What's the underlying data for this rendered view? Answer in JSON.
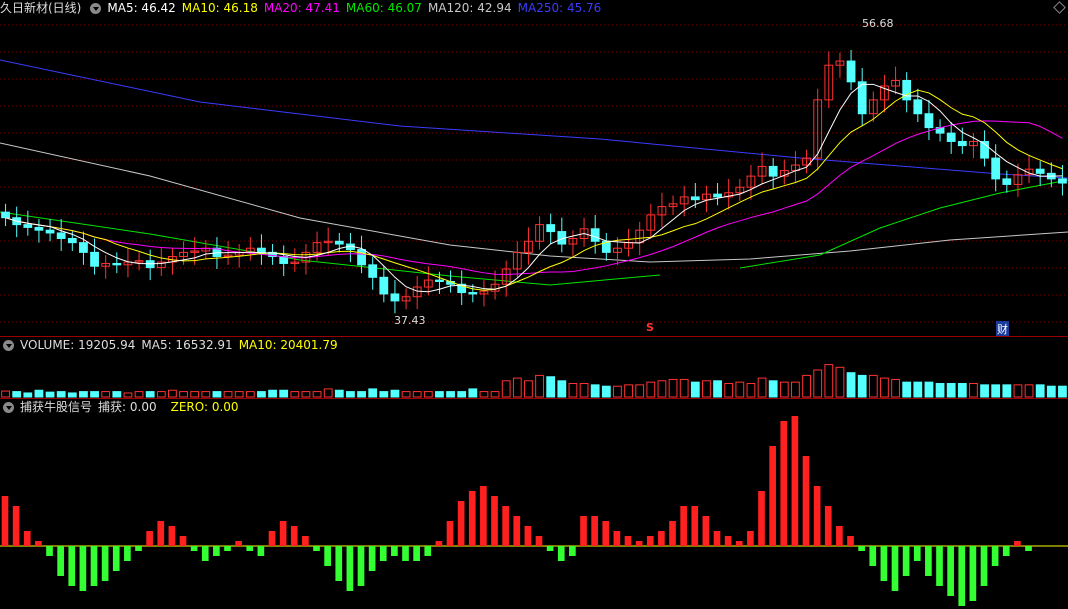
{
  "colors": {
    "up": "#ff3232",
    "down": "#54ffff",
    "ma5": "#ffffff",
    "ma10": "#ffff00",
    "ma20": "#ff00ff",
    "ma60": "#00e600",
    "ma120": "#c8c8c8",
    "ma250": "#3b3bff",
    "grid": "#7a0000",
    "sep": "#9a0000"
  },
  "main": {
    "title": "久日新材(日线)",
    "ma5": "MA5: 46.42",
    "ma10": "MA10: 46.18",
    "ma20": "MA20: 47.41",
    "ma60": "MA60: 46.07",
    "ma120": "MA120: 42.94",
    "ma250": "MA250: 45.76",
    "high_label": "56.68",
    "low_label": "37.43",
    "marker_s": "S",
    "marker_cai": "财"
  },
  "volume": {
    "title": "VOLUME: 19205.94",
    "ma5": "MA5: 16532.91",
    "ma10": "MA10: 20401.79"
  },
  "indicator": {
    "title": "捕获牛股信号",
    "capture": "捕获: 0.00",
    "zero": "ZERO: 0.00"
  },
  "series": {
    "closes": [
      44.1,
      43.6,
      43.4,
      43.2,
      43.0,
      42.6,
      42.3,
      41.6,
      40.6,
      40.8,
      40.7,
      40.9,
      41.0,
      40.5,
      40.9,
      41.3,
      41.6,
      41.7,
      41.9,
      41.3,
      41.4,
      41.6,
      41.9,
      41.6,
      41.3,
      40.8,
      40.9,
      41.6,
      42.3,
      42.4,
      42.2,
      41.8,
      40.7,
      39.8,
      38.6,
      38.1,
      38.4,
      39.1,
      39.6,
      39.5,
      39.3,
      38.7,
      38.6,
      38.8,
      39.3,
      40.4,
      41.6,
      42.4,
      43.6,
      43.1,
      42.2,
      42.6,
      43.3,
      42.4,
      41.6,
      41.9,
      42.3,
      43.2,
      44.3,
      44.9,
      45.1,
      45.6,
      45.4,
      45.8,
      45.6,
      45.9,
      46.3,
      47.1,
      47.8,
      47.1,
      47.5,
      47.9,
      48.4,
      52.6,
      55.1,
      55.4,
      53.9,
      51.6,
      52.6,
      53.6,
      54.0,
      52.6,
      51.6,
      50.6,
      50.2,
      49.6,
      49.3,
      49.6,
      48.4,
      46.9,
      46.5,
      47.2,
      47.6,
      47.3,
      46.9,
      46.6
    ],
    "volume": [
      0.22,
      0.2,
      0.15,
      0.25,
      0.18,
      0.2,
      0.15,
      0.2,
      0.2,
      0.2,
      0.2,
      0.15,
      0.2,
      0.2,
      0.2,
      0.25,
      0.2,
      0.2,
      0.2,
      0.2,
      0.2,
      0.2,
      0.2,
      0.2,
      0.25,
      0.25,
      0.2,
      0.2,
      0.2,
      0.3,
      0.25,
      0.2,
      0.2,
      0.3,
      0.2,
      0.25,
      0.2,
      0.2,
      0.2,
      0.2,
      0.2,
      0.2,
      0.3,
      0.2,
      0.2,
      0.6,
      0.7,
      0.6,
      0.8,
      0.75,
      0.6,
      0.5,
      0.5,
      0.45,
      0.4,
      0.4,
      0.45,
      0.45,
      0.55,
      0.6,
      0.65,
      0.65,
      0.55,
      0.6,
      0.6,
      0.5,
      0.55,
      0.5,
      0.7,
      0.6,
      0.55,
      0.55,
      0.8,
      1.0,
      1.2,
      1.1,
      0.9,
      0.8,
      0.8,
      0.7,
      0.65,
      0.55,
      0.55,
      0.55,
      0.5,
      0.5,
      0.5,
      0.5,
      0.45,
      0.45,
      0.45,
      0.45,
      0.45,
      0.45,
      0.4,
      0.4
    ],
    "signal": [
      1.0,
      0.8,
      0.3,
      0.1,
      -0.2,
      -0.6,
      -0.8,
      -0.9,
      -0.8,
      -0.7,
      -0.5,
      -0.3,
      -0.1,
      0.3,
      0.5,
      0.4,
      0.2,
      -0.1,
      -0.3,
      -0.2,
      -0.1,
      0.1,
      -0.1,
      -0.2,
      0.3,
      0.5,
      0.4,
      0.2,
      -0.1,
      -0.4,
      -0.7,
      -0.9,
      -0.8,
      -0.5,
      -0.3,
      -0.2,
      -0.3,
      -0.3,
      -0.2,
      0.1,
      0.5,
      0.9,
      1.1,
      1.2,
      1.0,
      0.8,
      0.6,
      0.4,
      0.2,
      -0.1,
      -0.3,
      -0.2,
      0.6,
      0.6,
      0.5,
      0.3,
      0.2,
      0.1,
      0.2,
      0.3,
      0.5,
      0.8,
      0.8,
      0.6,
      0.3,
      0.2,
      0.1,
      0.3,
      1.1,
      2.0,
      2.5,
      2.6,
      1.8,
      1.2,
      0.8,
      0.4,
      0.2,
      -0.1,
      -0.4,
      -0.7,
      -0.9,
      -0.6,
      -0.3,
      -0.6,
      -0.8,
      -1.0,
      -1.2,
      -1.1,
      -0.8,
      -0.4,
      -0.2,
      0.1,
      -0.1,
      0.0,
      0.0,
      0.0
    ],
    "price_range": [
      36,
      58
    ],
    "ma250_points": [
      [
        0,
        60
      ],
      [
        200,
        102
      ],
      [
        400,
        126
      ],
      [
        600,
        139
      ],
      [
        800,
        158
      ],
      [
        1000,
        174
      ],
      [
        1068,
        178
      ]
    ],
    "ma120_points": [
      [
        0,
        143
      ],
      [
        150,
        176
      ],
      [
        300,
        218
      ],
      [
        450,
        245
      ],
      [
        550,
        256
      ],
      [
        650,
        262
      ],
      [
        750,
        259
      ],
      [
        850,
        251
      ],
      [
        950,
        240
      ],
      [
        1068,
        232
      ]
    ],
    "ma60_points": [
      [
        0,
        212
      ],
      [
        150,
        234
      ],
      [
        300,
        260
      ],
      [
        450,
        276
      ],
      [
        550,
        285
      ],
      [
        660,
        275
      ]
    ],
    "ma60b_points": [
      [
        740,
        268
      ],
      [
        820,
        255
      ],
      [
        880,
        228
      ],
      [
        940,
        208
      ],
      [
        1000,
        193
      ],
      [
        1068,
        180
      ]
    ]
  }
}
